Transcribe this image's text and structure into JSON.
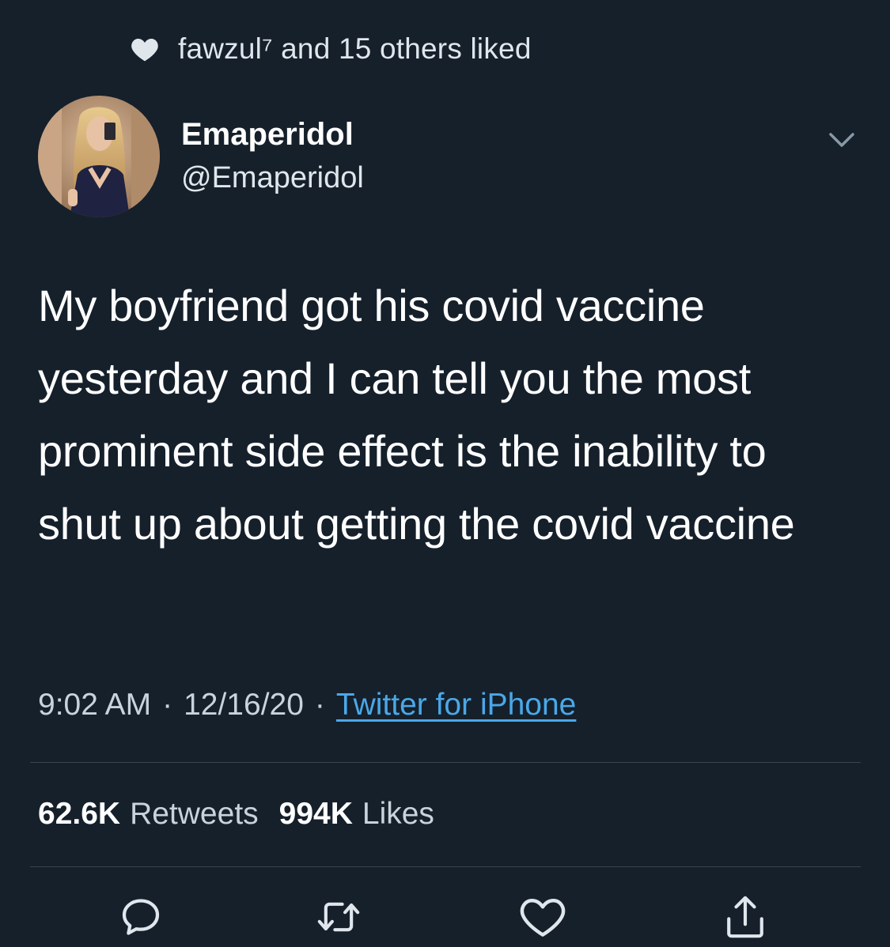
{
  "social_context": {
    "icon": "heart-filled-icon",
    "text": "fawzul⁷ and 15 others liked"
  },
  "author": {
    "avatar": "profile-photo",
    "display_name": "Emaperidol",
    "handle": "@Emaperidol"
  },
  "tweet": {
    "text": "My boyfriend got his covid vaccine yesterday and I can tell you the most prominent side effect is the inability to shut up about getting the covid vaccine",
    "time": "9:02 AM",
    "date": "12/16/20",
    "separator": "·",
    "source": "Twitter for iPhone"
  },
  "stats": {
    "retweets_count": "62.6K",
    "retweets_label": "Retweets",
    "likes_count": "994K",
    "likes_label": "Likes"
  },
  "actions": {
    "reply_icon": "reply-icon",
    "retweet_icon": "retweet-icon",
    "like_icon": "heart-outline-icon",
    "share_icon": "share-icon"
  },
  "colors": {
    "background": "#15202b",
    "accent_link": "#4aa8e8",
    "secondary_text": "#c9d3dc",
    "divider": "#38444d"
  }
}
